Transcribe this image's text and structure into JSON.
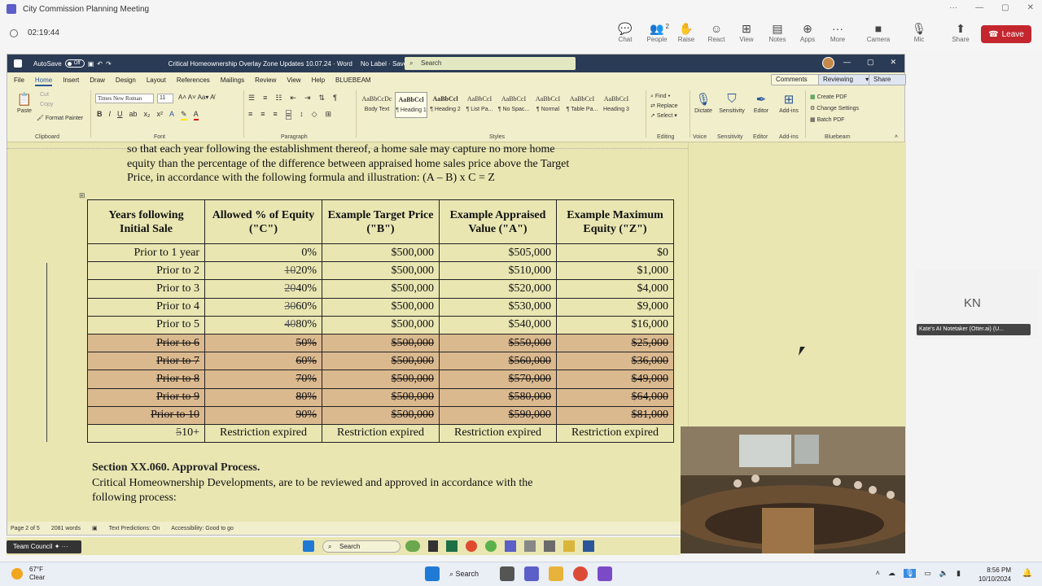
{
  "teams": {
    "window_title": "City Commission Planning Meeting",
    "timer": "02:19:44",
    "toolbar": [
      {
        "label": "Chat",
        "icon": "chat-icon",
        "glyph": "💬"
      },
      {
        "label": "People",
        "icon": "people-icon",
        "glyph": "👥",
        "badge": "2"
      },
      {
        "label": "Raise",
        "icon": "raise-hand-icon",
        "glyph": "✋"
      },
      {
        "label": "React",
        "icon": "react-icon",
        "glyph": "☺"
      },
      {
        "label": "View",
        "icon": "view-icon",
        "glyph": "⊞"
      },
      {
        "label": "Notes",
        "icon": "notes-icon",
        "glyph": "▤"
      },
      {
        "label": "Apps",
        "icon": "apps-icon",
        "glyph": "⊕"
      },
      {
        "label": "More",
        "icon": "more-icon",
        "glyph": "···"
      },
      {
        "label": "Camera",
        "icon": "camera-icon",
        "glyph": "■"
      },
      {
        "label": "Mic",
        "icon": "mic-icon",
        "glyph": "🎙"
      },
      {
        "label": "Share",
        "icon": "share-icon",
        "glyph": "⬆"
      }
    ],
    "leave_label": "Leave",
    "participant_initials": "KN",
    "participant_name": "Kate's AI Notetaker (Otter.ai) (U..."
  },
  "word": {
    "autosave_label": "AutoSave",
    "autosave_state": "Off",
    "doc_title": "Critical Homeownership Overlay Zone Updates 10.07.24 · Word",
    "label_status": "No Label · Saved to X: Drive",
    "search_placeholder": "Search",
    "menu": [
      "File",
      "Home",
      "Insert",
      "Draw",
      "Design",
      "Layout",
      "References",
      "Mailings",
      "Review",
      "View",
      "Help",
      "BLUEBEAM"
    ],
    "comments_label": "Comments",
    "reviewing_label": "Reviewing",
    "share_label": "Share",
    "font_name": "Times New Roman",
    "font_size": "11",
    "paste_label": "Paste",
    "cut_label": "Cut",
    "copy_label": "Copy",
    "format_painter_label": "Format Painter",
    "groups": [
      "Clipboard",
      "Font",
      "Paragraph",
      "Styles",
      "Editing",
      "Voice",
      "Sensitivity",
      "Editor",
      "Add-ins",
      "Bluebeam"
    ],
    "styles": [
      {
        "preview": "AaBbCcDc",
        "name": "Body Text"
      },
      {
        "preview": "AaBbCcl",
        "name": "¶ Heading 1"
      },
      {
        "preview": "AaBbCcl",
        "name": "¶ Heading 2"
      },
      {
        "preview": "AaBbCcI",
        "name": "¶ List Pa..."
      },
      {
        "preview": "AaBbCcI",
        "name": "¶ No Spac..."
      },
      {
        "preview": "AaBbCcI",
        "name": "¶ Normal"
      },
      {
        "preview": "AaBbCcI",
        "name": "¶ Table Pa..."
      },
      {
        "preview": "AaBbCcI",
        "name": "Heading 3"
      }
    ],
    "editing": [
      "Find",
      "Replace",
      "Select"
    ],
    "dictate_label": "Dictate",
    "sensitivity_label": "Sensitivity",
    "editor_label": "Editor",
    "addins_label": "Add-ins",
    "bluebeam": [
      "Create PDF",
      "Change Settings",
      "Batch PDF"
    ],
    "status": {
      "page": "Page 2 of 5",
      "words": "2081 words",
      "predictions": "Text Predictions: On",
      "accessibility": "Accessibility: Good to go"
    }
  },
  "document": {
    "intro_lines": [
      "so that each year following the establishment thereof, a home sale may capture no more home",
      "equity than the percentage of the difference between appraised home sales price above the Target",
      "Price, in accordance with the following formula and illustration:  (A – B) x C = Z"
    ],
    "table": {
      "headers": [
        "Years following Initial Sale",
        "Allowed % of Equity (\"C\")",
        "Example Target Price (\"B\")",
        "Example Appraised Value (\"A\")",
        "Example Maximum Equity (\"Z\")"
      ],
      "rows": [
        {
          "year": "Prior to 1 year",
          "old": "",
          "pct": "0%",
          "target": "$500,000",
          "appraised": "$505,000",
          "equity": "$0",
          "struck": false
        },
        {
          "year": "Prior to 2",
          "old": "10",
          "pct": "20%",
          "target": "$500,000",
          "appraised": "$510,000",
          "equity": "$1,000",
          "struck": false
        },
        {
          "year": "Prior to 3",
          "old": "20",
          "pct": "40%",
          "target": "$500,000",
          "appraised": "$520,000",
          "equity": "$4,000",
          "struck": false
        },
        {
          "year": "Prior to 4",
          "old": "30",
          "pct": "60%",
          "target": "$500,000",
          "appraised": "$530,000",
          "equity": "$9,000",
          "struck": false
        },
        {
          "year": "Prior to 5",
          "old": "40",
          "pct": "80%",
          "target": "$500,000",
          "appraised": "$540,000",
          "equity": "$16,000",
          "struck": false
        },
        {
          "year": "Prior to 6",
          "old": "",
          "pct": "50%",
          "target": "$500,000",
          "appraised": "$550,000",
          "equity": "$25,000",
          "struck": true
        },
        {
          "year": "Prior to 7",
          "old": "",
          "pct": "60%",
          "target": "$500,000",
          "appraised": "$560,000",
          "equity": "$36,000",
          "struck": true
        },
        {
          "year": "Prior to 8",
          "old": "",
          "pct": "70%",
          "target": "$500,000",
          "appraised": "$570,000",
          "equity": "$49,000",
          "struck": true
        },
        {
          "year": "Prior to 9",
          "old": "",
          "pct": "80%",
          "target": "$500,000",
          "appraised": "$580,000",
          "equity": "$64,000",
          "struck": true
        },
        {
          "year": "Prior to 10",
          "old": "",
          "pct": "90%",
          "target": "$500,000",
          "appraised": "$590,000",
          "equity": "$81,000",
          "struck": true
        }
      ],
      "last_row": {
        "old": "5",
        "year": "10+",
        "expired": "Restriction expired"
      }
    },
    "section_heading": "Section XX.060. Approval Process.",
    "section_lines": [
      "Critical Homeownership Developments, are to be reviewed and approved in accordance with the",
      "following process:"
    ]
  },
  "inner_taskbar": {
    "app_label": "Team Council",
    "search_placeholder": "Search"
  },
  "windows": {
    "weather_temp": "67°F",
    "weather_desc": "Clear",
    "search_label": "Search",
    "time": "8:56 PM",
    "date": "10/10/2024"
  }
}
